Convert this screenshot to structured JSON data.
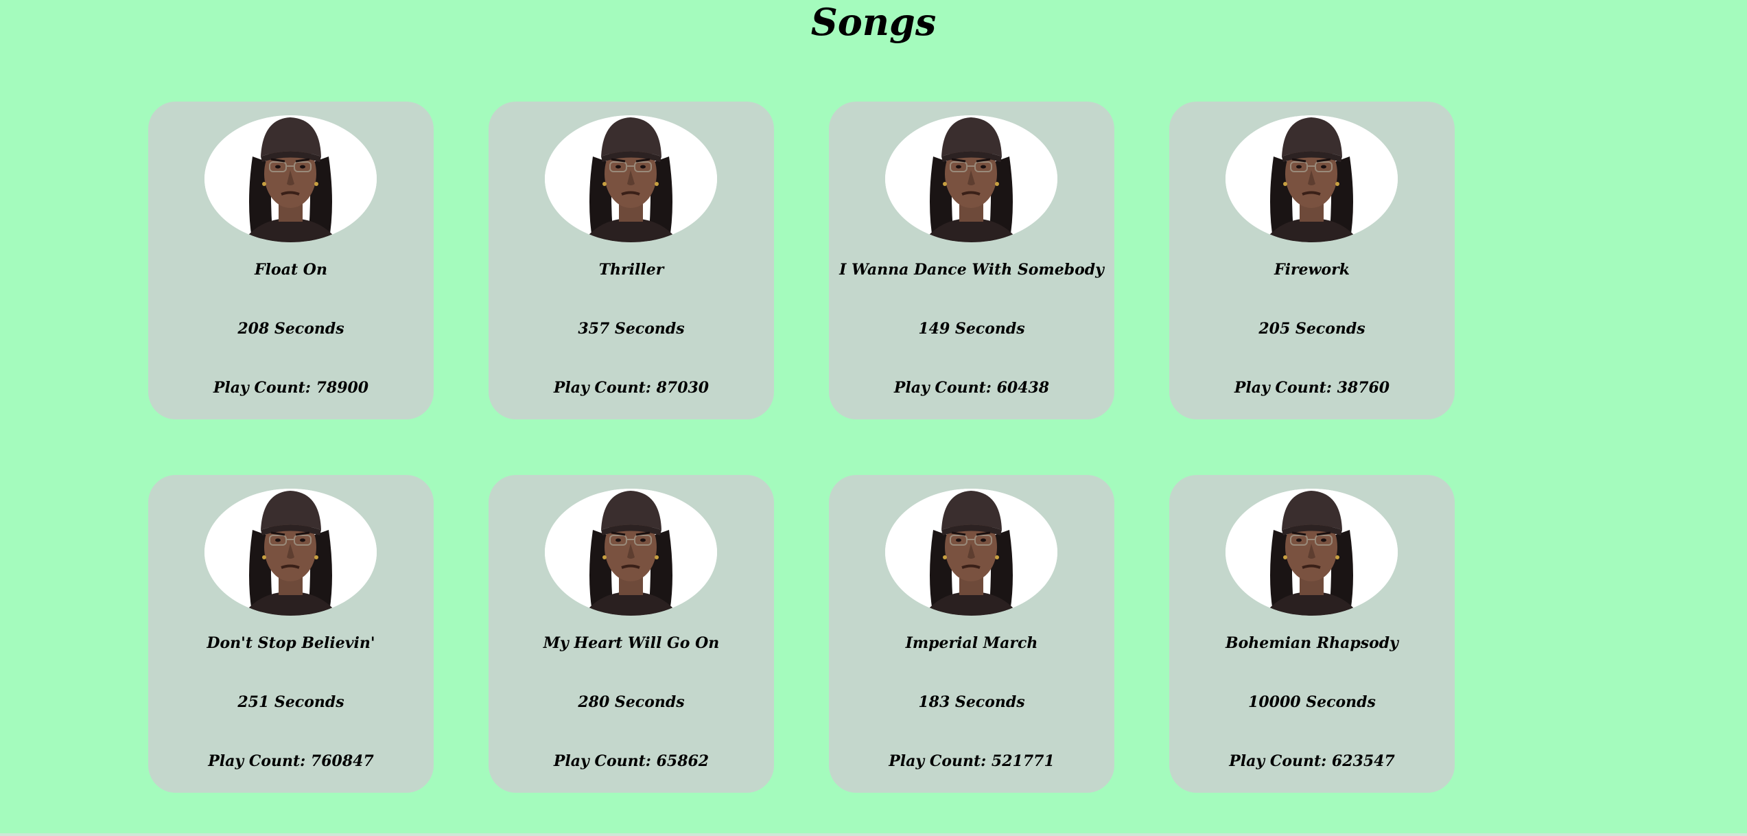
{
  "page": {
    "title": "Songs",
    "background": "#a4fbbd",
    "card_background": "#c4d7cc"
  },
  "songs": [
    {
      "title": "Float On",
      "duration": "208 Seconds",
      "play_count": "Play Count: 78900",
      "icon": "artist-photo-icon"
    },
    {
      "title": "Thriller",
      "duration": "357 Seconds",
      "play_count": "Play Count: 87030",
      "icon": "artist-photo-icon"
    },
    {
      "title": "I Wanna Dance With Somebody",
      "duration": "149 Seconds",
      "play_count": "Play Count: 60438",
      "icon": "artist-photo-icon"
    },
    {
      "title": "Firework",
      "duration": "205 Seconds",
      "play_count": "Play Count: 38760",
      "icon": "artist-photo-icon"
    },
    {
      "title": "Don't Stop Believin'",
      "duration": "251 Seconds",
      "play_count": "Play Count: 760847",
      "icon": "artist-photo-icon"
    },
    {
      "title": "My Heart Will Go On",
      "duration": "280 Seconds",
      "play_count": "Play Count: 65862",
      "icon": "artist-photo-icon"
    },
    {
      "title": "Imperial March",
      "duration": "183 Seconds",
      "play_count": "Play Count: 521771",
      "icon": "artist-photo-icon"
    },
    {
      "title": "Bohemian Rhapsody",
      "duration": "10000 Seconds",
      "play_count": "Play Count: 623547",
      "icon": "artist-photo-icon"
    }
  ]
}
